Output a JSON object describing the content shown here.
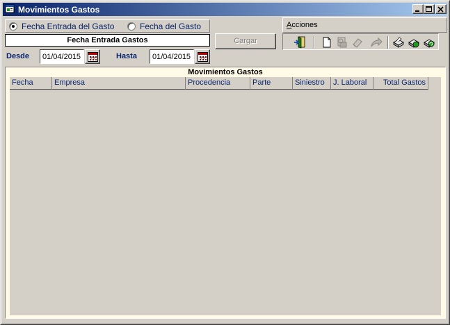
{
  "window": {
    "title": "Movimientos Gastos"
  },
  "filter": {
    "options": [
      {
        "label": "Fecha Entrada del Gasto",
        "selected": true
      },
      {
        "label": "Fecha del Gasto",
        "selected": false
      }
    ],
    "date_header": "Fecha Entrada Gastos",
    "from_label": "Desde",
    "from_value": "01/04/2015",
    "to_label": "Hasta",
    "to_value": "01/04/2015",
    "load_button": "Cargar"
  },
  "actions": {
    "label_accel": "A",
    "label_rest": "cciones",
    "buttons": [
      "exit-icon",
      "new-document-icon",
      "print-preview-icon",
      "eraser-icon",
      "redo-arrow-icon",
      "printer-icon",
      "export-icon",
      "refresh-icon"
    ]
  },
  "grid": {
    "title": "Movimientos Gastos",
    "columns": [
      "Fecha",
      "Empresa",
      "Procedencia",
      "Parte",
      "Siniestro",
      "J. Laboral",
      "Total Gastos"
    ],
    "rows": []
  },
  "colors": {
    "title_bar_start": "#0a246a",
    "title_bar_end": "#a6caf0",
    "label_blue": "#0a246a",
    "grid_background": "#fffbe6"
  }
}
